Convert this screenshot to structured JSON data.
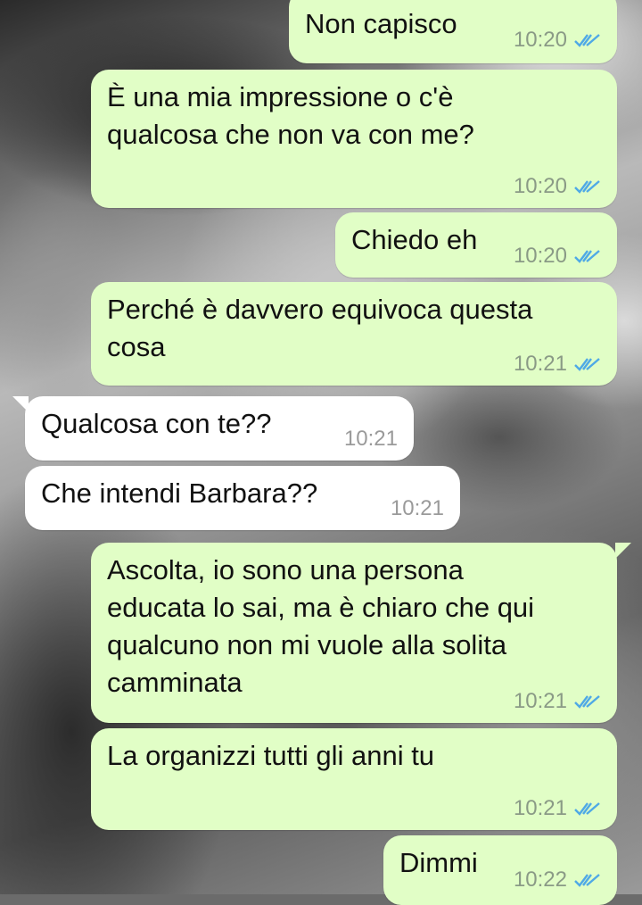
{
  "colors": {
    "outgoing_bubble": "#e1fec6",
    "incoming_bubble": "#ffffff",
    "read_ticks": "#4fa9e6"
  },
  "messages": [
    {
      "direction": "out",
      "text_lines": [
        "Non capisco"
      ],
      "time": "10:20",
      "status_icon": "double-check-read-icon"
    },
    {
      "direction": "out",
      "text_lines": [
        "È una mia impressione o c'è",
        "qualcosa che non va con me?"
      ],
      "time": "10:20",
      "status_icon": "double-check-read-icon"
    },
    {
      "direction": "out",
      "text_lines": [
        "Chiedo eh"
      ],
      "time": "10:20",
      "status_icon": "double-check-read-icon"
    },
    {
      "direction": "out",
      "text_lines": [
        "Perché è davvero equivoca questa",
        "cosa"
      ],
      "time": "10:21",
      "status_icon": "double-check-read-icon"
    },
    {
      "direction": "in",
      "text_lines": [
        "Qualcosa con te??"
      ],
      "time": "10:21"
    },
    {
      "direction": "in",
      "text_lines": [
        "Che intendi Barbara??"
      ],
      "time": "10:21"
    },
    {
      "direction": "out",
      "text_lines": [
        "Ascolta, io sono una persona",
        "educata lo sai, ma è chiaro che qui",
        "qualcuno non mi vuole alla solita",
        "camminata"
      ],
      "time": "10:21",
      "status_icon": "double-check-read-icon"
    },
    {
      "direction": "out",
      "text_lines": [
        "La organizzi tutti gli anni tu"
      ],
      "time": "10:21",
      "status_icon": "double-check-read-icon"
    },
    {
      "direction": "out",
      "text_lines": [
        "Dimmi"
      ],
      "time": "10:22",
      "status_icon": "double-check-read-icon"
    }
  ]
}
